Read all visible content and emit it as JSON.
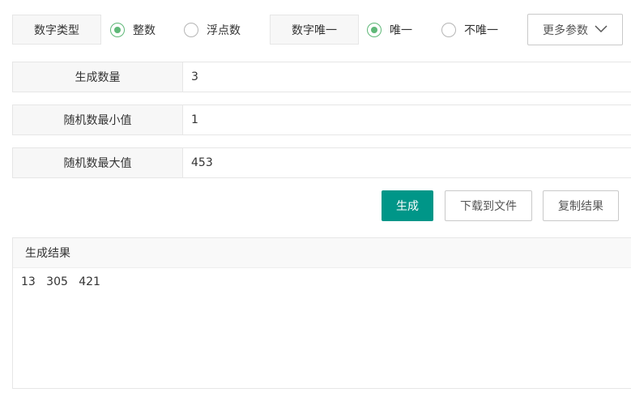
{
  "options": {
    "number_type_label": "数字类型",
    "number_type_options": [
      {
        "label": "整数",
        "checked": true
      },
      {
        "label": "浮点数",
        "checked": false
      }
    ],
    "unique_label": "数字唯一",
    "unique_options": [
      {
        "label": "唯一",
        "checked": true
      },
      {
        "label": "不唯一",
        "checked": false
      }
    ],
    "more_params_label": "更多参数",
    "more_params_icon": "chevron-down-icon"
  },
  "fields": {
    "count": {
      "label": "生成数量",
      "value": "3"
    },
    "min": {
      "label": "随机数最小值",
      "value": "1"
    },
    "max": {
      "label": "随机数最大值",
      "value": "453"
    }
  },
  "actions": {
    "generate_label": "生成",
    "download_label": "下载到文件",
    "copy_label": "复制结果"
  },
  "result": {
    "title": "生成结果",
    "content": "13   305   421"
  },
  "colors": {
    "primary": "#009688",
    "radio_checked": "#5fb878",
    "label_bg": "#f7f7f7",
    "border": "#e6e6e6"
  }
}
